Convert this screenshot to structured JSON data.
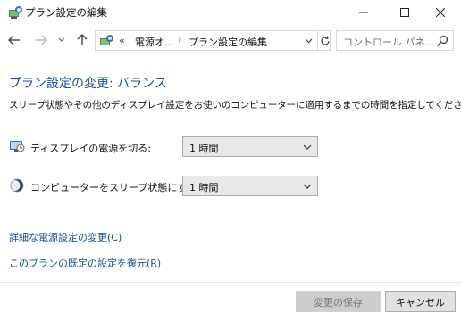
{
  "window": {
    "title": "プラン設定の編集",
    "controls": {
      "minimize_icon": "minimize-icon",
      "maximize_icon": "maximize-icon",
      "close_icon": "close-icon"
    }
  },
  "navigation": {
    "breadcrumb_prefix": "«",
    "breadcrumb": [
      "電源オ...",
      "プラン設定の編集"
    ],
    "breadcrumb_separator": "›",
    "search_placeholder": "コントロール パネ..."
  },
  "main": {
    "heading": "プラン設定の変更: バランス",
    "description": "スリープ状態やその他のディスプレイ設定をお使いのコンピューターに適用するまでの時間を指定してください。",
    "settings": [
      {
        "label": "ディスプレイの電源を切る:",
        "value": "1 時間",
        "icon": "display-icon"
      },
      {
        "label": "コンピューターをスリープ状態にする:",
        "value": "1 時間",
        "icon": "sleep-moon-icon"
      }
    ],
    "links": [
      "詳細な電源設定の変更(C)",
      "このプランの既定の設定を復元(R)"
    ]
  },
  "footer": {
    "save_label": "変更の保存",
    "cancel_label": "キャンセル"
  },
  "colors": {
    "heading": "#1a4d9c",
    "link": "#1a4d9c",
    "disabled_button": "#cccccc",
    "button": "#e1e1e1"
  }
}
